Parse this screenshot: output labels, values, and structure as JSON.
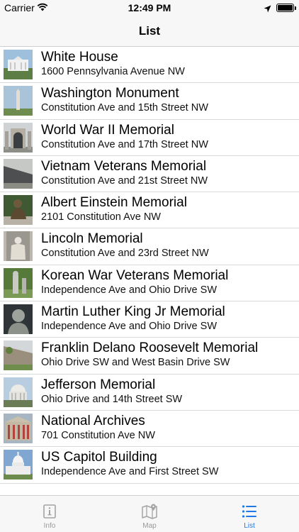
{
  "status_bar": {
    "carrier": "Carrier",
    "time": "12:49 PM"
  },
  "nav": {
    "title": "List"
  },
  "items": [
    {
      "title": "White House",
      "subtitle": "1600 Pennsylvania Avenue NW"
    },
    {
      "title": "Washington Monument",
      "subtitle": "Constitution Ave and 15th Street NW"
    },
    {
      "title": "World War II Memorial",
      "subtitle": "Constitution Ave and 17th Street NW"
    },
    {
      "title": "Vietnam Veterans Memorial",
      "subtitle": "Constitution Ave and 21st Street NW"
    },
    {
      "title": "Albert Einstein Memorial",
      "subtitle": "2101 Constitution Ave NW"
    },
    {
      "title": "Lincoln Memorial",
      "subtitle": "Constitution Ave and 23rd Street NW"
    },
    {
      "title": "Korean War Veterans Memorial",
      "subtitle": "Independence Ave and Ohio Drive SW"
    },
    {
      "title": "Martin Luther King Jr Memorial",
      "subtitle": "Independence Ave and Ohio Drive SW"
    },
    {
      "title": "Franklin Delano Roosevelt Memorial",
      "subtitle": "Ohio Drive SW and West Basin Drive SW"
    },
    {
      "title": "Jefferson Memorial",
      "subtitle": "Ohio Drive and 14th Street SW"
    },
    {
      "title": "National Archives",
      "subtitle": "701 Constitution Ave NW"
    },
    {
      "title": "US Capitol Building",
      "subtitle": "Independence Ave and First Street SW"
    }
  ],
  "tabs": [
    {
      "label": "Info",
      "icon": "info-icon",
      "active": false
    },
    {
      "label": "Map",
      "icon": "map-icon",
      "active": false
    },
    {
      "label": "List",
      "icon": "list-icon",
      "active": true
    }
  ],
  "colors": {
    "accent": "#1f7ae8",
    "inactive": "#9a9a9a",
    "bar_background": "#f7f7f7"
  }
}
